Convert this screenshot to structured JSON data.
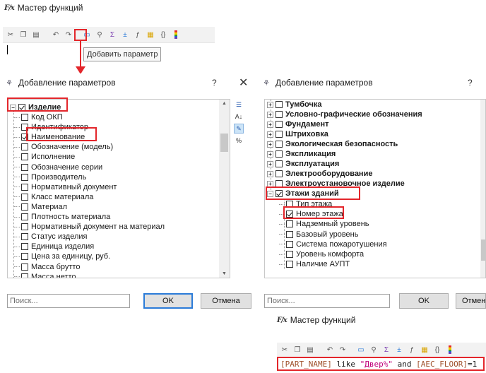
{
  "wizard_top": {
    "title": "Мастер функций",
    "logo": "F/x",
    "tooltip": "Добавить параметр",
    "toolbar_icons": [
      "cut-icon",
      "copy-icon",
      "paste-icon",
      "undo-icon",
      "redo-icon",
      "add-parameter-icon",
      "tree-icon",
      "syntax-icon",
      "operators-icon",
      "functions-icon",
      "snippets-icon",
      "braces-icon",
      "colors-icon"
    ]
  },
  "dialog_left": {
    "title": "Добавление параметров",
    "help": "?",
    "close": "✕",
    "root": "Изделие",
    "items": [
      {
        "label": "Код ОКП",
        "checked": false
      },
      {
        "label": "Идентификатор",
        "checked": false
      },
      {
        "label": "Наименование",
        "checked": true
      },
      {
        "label": "Обозначение (модель)",
        "checked": false
      },
      {
        "label": "Исполнение",
        "checked": false
      },
      {
        "label": "Обозначение серии",
        "checked": false
      },
      {
        "label": "Производитель",
        "checked": false
      },
      {
        "label": "Нормативный документ",
        "checked": false
      },
      {
        "label": "Класс материала",
        "checked": false
      },
      {
        "label": "Материал",
        "checked": false
      },
      {
        "label": "Плотность материала",
        "checked": false
      },
      {
        "label": "Нормативный документ на материал",
        "checked": false
      },
      {
        "label": "Статус изделия",
        "checked": false
      },
      {
        "label": "Единица изделия",
        "checked": false
      },
      {
        "label": "Цена за единицу, руб.",
        "checked": false
      },
      {
        "label": "Масса брутто",
        "checked": false
      },
      {
        "label": "Масса нетто",
        "checked": false
      }
    ],
    "search_placeholder": "Поиск...",
    "ok": "OK",
    "cancel": "Отмена"
  },
  "dialog_right": {
    "title": "Добавление параметров",
    "help": "?",
    "groups": [
      "Тумбочка",
      "Условно-графические обозначения",
      "Фундамент",
      "Штриховка",
      "Экологическая безопасность",
      "Экспликация",
      "Эксплуатация",
      "Электрооборудование",
      "Электроустановочное изделие"
    ],
    "expanded_group": "Этажи зданий",
    "items": [
      {
        "label": "Тип этажа",
        "checked": false
      },
      {
        "label": "Номер этажа",
        "checked": true
      },
      {
        "label": "Надземный уровень",
        "checked": false
      },
      {
        "label": "Базовый уровень",
        "checked": false
      },
      {
        "label": "Система пожаротушения",
        "checked": false
      },
      {
        "label": "Уровень комфорта",
        "checked": false
      },
      {
        "label": "Наличие АУПТ",
        "checked": false
      }
    ],
    "search_placeholder": "Поиск...",
    "ok": "OK",
    "cancel": "Отмена"
  },
  "wizard_bottom": {
    "title": "Мастер функций",
    "logo": "F/x",
    "formula": {
      "part1": "[PART_NAME]",
      "kw1": " like ",
      "str": "\"Двер%\"",
      "kw2": " and ",
      "part2": "[AEC_FLOOR]",
      "tail": "=1"
    }
  },
  "colors": {
    "highlight": "#e3262b",
    "accent": "#2b7bd8",
    "param": "#a0522d",
    "string": "#c0007a",
    "keyword": "#1a1a1a"
  }
}
